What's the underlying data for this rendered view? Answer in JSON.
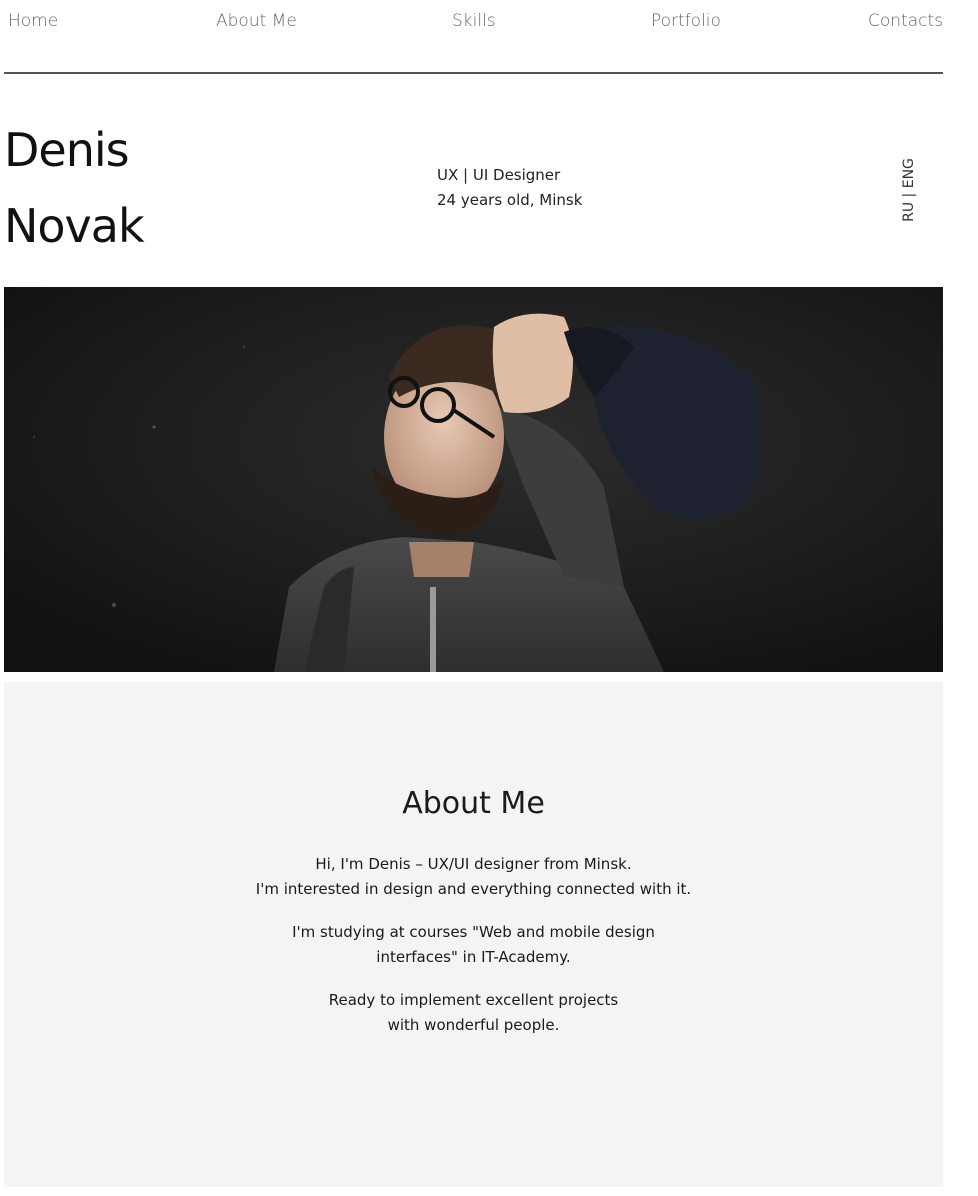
{
  "nav": {
    "items": [
      {
        "label": "Home"
      },
      {
        "label": "About Me"
      },
      {
        "label": "Skills"
      },
      {
        "label": "Portfolio"
      },
      {
        "label": "Contacts"
      }
    ]
  },
  "header": {
    "first_name": "Denis",
    "last_name": "Novak",
    "role": "UX | UI Designer",
    "details": "24 years old, Minsk",
    "lang": {
      "ru": "RU",
      "separator": "|",
      "eng": "ENG"
    }
  },
  "hero": {
    "icon": "photo-man-with-cap"
  },
  "about": {
    "title": "About Me",
    "paragraphs": [
      {
        "line1": "Hi, I'm Denis – UX/UI designer from Minsk.",
        "line2": "I'm interested in design and everything connected with it."
      },
      {
        "line1": "I'm studying at courses \"Web and mobile design",
        "line2": "interfaces\" in IT-Academy."
      },
      {
        "line1": "Ready to implement excellent projects",
        "line2": "with wonderful people."
      }
    ]
  },
  "colors": {
    "nav_text": "#666666",
    "divider": "#555555",
    "about_bg": "#f4f4f4",
    "hero_bg": "#1b1b1b"
  }
}
